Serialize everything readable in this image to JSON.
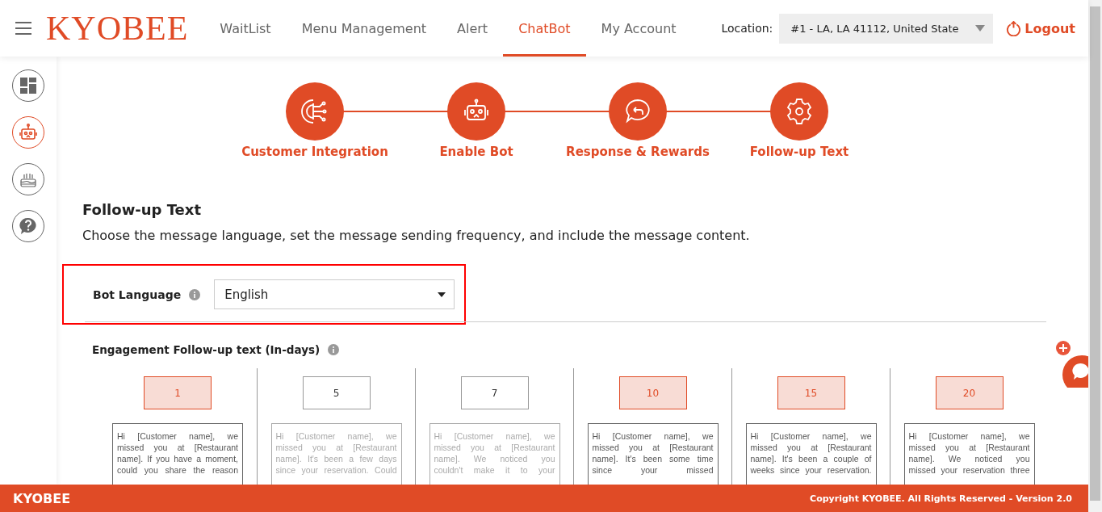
{
  "header": {
    "logo": "KYOBEE",
    "nav": [
      {
        "label": "WaitList",
        "selected": false
      },
      {
        "label": "Menu Management",
        "selected": false
      },
      {
        "label": "Alert",
        "selected": false
      },
      {
        "label": "ChatBot",
        "selected": true
      },
      {
        "label": "My Account",
        "selected": false
      }
    ],
    "location_label": "Location:",
    "location_value": "#1 - LA, LA 41112, United State",
    "logout": "Logout"
  },
  "sidebar": {
    "items": [
      {
        "kind": "dashboard",
        "selected": false
      },
      {
        "kind": "robot",
        "selected": true
      },
      {
        "kind": "cake",
        "selected": false
      },
      {
        "kind": "help",
        "selected": false
      }
    ]
  },
  "steps": [
    {
      "kind": "integration",
      "label": "Customer Integration"
    },
    {
      "kind": "robot",
      "label": "Enable Bot"
    },
    {
      "kind": "reply",
      "label": "Response & Rewards"
    },
    {
      "kind": "gear",
      "label": "Follow-up Text"
    }
  ],
  "section": {
    "title": "Follow-up Text",
    "description": "Choose the message language, set the message sending frequency, and include the message content."
  },
  "bot_language": {
    "label": "Bot Language",
    "value": "English"
  },
  "engagement": {
    "title": "Engagement Follow-up text (In-days)",
    "days": [
      {
        "day": "1",
        "selected": true,
        "lines": [
          "Hi [Customer name], we",
          "missed you at [Restaurant",
          "name]. If you have a moment,",
          "could you share the reason"
        ]
      },
      {
        "day": "5",
        "selected": false,
        "lines": [
          "Hi [Customer name], we",
          "missed you at [Restaurant",
          "name]. It's been a few days",
          "since your reservation. Could"
        ]
      },
      {
        "day": "7",
        "selected": false,
        "lines": [
          "Hi [Customer name], we",
          "missed you at [Restaurant",
          "name]. We noticed you",
          "couldn't make it to your"
        ]
      },
      {
        "day": "10",
        "selected": true,
        "lines": [
          "Hi [Customer name], we",
          "missed you at [Restaurant",
          "name]. It's been some time",
          "since your missed"
        ]
      },
      {
        "day": "15",
        "selected": true,
        "lines": [
          "Hi [Customer name], we",
          "missed you at [Restaurant",
          "name]. It's been a couple of",
          "weeks since your reservation."
        ]
      },
      {
        "day": "20",
        "selected": true,
        "lines": [
          "Hi [Customer name], we",
          "missed you at [Restaurant",
          "name]. We noticed you",
          "missed your reservation three"
        ]
      }
    ]
  },
  "footer": {
    "brand": "KYOBEE",
    "copyright": "Copyright KYOBEE. All Rights Reserved - Version 2.0"
  }
}
